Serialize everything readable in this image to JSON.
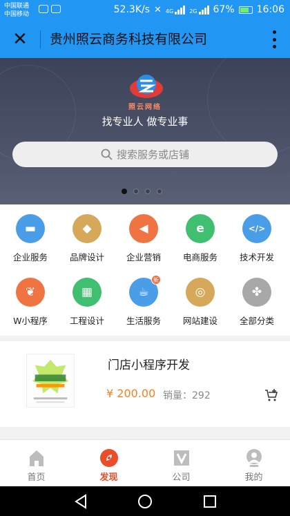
{
  "status_bar": {
    "carrier_1": "中国联通",
    "carrier_2": "中国移动",
    "net_speed": "52.3K/s",
    "sig1_tag": "4G",
    "sig2_tag": "2G",
    "battery": "67%",
    "time": "16:06"
  },
  "titlebar": {
    "title": "贵州照云商务科技有限公司"
  },
  "banner": {
    "logo_text": "照云网络",
    "slogan": "找专业人 做专业事",
    "search_placeholder": "搜索服务或店铺",
    "dots_total": 4,
    "dots_active": 1
  },
  "categories": [
    {
      "label": "企业服务",
      "icon": "briefcase-icon",
      "color": "#4a9ee8",
      "glyph": "▬"
    },
    {
      "label": "品牌设计",
      "icon": "tag-icon",
      "color": "#d6a85a",
      "glyph": "◆"
    },
    {
      "label": "企业营销",
      "icon": "megaphone-icon",
      "color": "#ef7441",
      "glyph": "◀"
    },
    {
      "label": "电商服务",
      "icon": "shopping-bag-icon",
      "color": "#3fbf6f",
      "glyph": "e"
    },
    {
      "label": "技术开发",
      "icon": "code-icon",
      "color": "#4a9ee8",
      "glyph": "</>"
    },
    {
      "label": "W小程序",
      "icon": "miniapp-icon",
      "color": "#ef7441",
      "glyph": "❦"
    },
    {
      "label": "工程设计",
      "icon": "building-icon",
      "color": "#3fbf6f",
      "glyph": "▦"
    },
    {
      "label": "生活服务",
      "icon": "coffee-icon",
      "color": "#4a9ee8",
      "glyph": "☕",
      "badge": "新"
    },
    {
      "label": "网站建设",
      "icon": "globe-icon",
      "color": "#d6a85a",
      "glyph": "◎"
    },
    {
      "label": "全部分类",
      "icon": "clover-icon",
      "color": "#a8a8a8",
      "glyph": "✤"
    }
  ],
  "product": {
    "name": "门店小程序开发",
    "price": "¥ 200.00",
    "sold": "销量：292"
  },
  "tabs": [
    {
      "label": "首页",
      "icon": "home-icon",
      "active": false
    },
    {
      "label": "发现",
      "icon": "discover-icon",
      "active": true
    },
    {
      "label": "公司",
      "icon": "company-icon",
      "active": false
    },
    {
      "label": "我的",
      "icon": "profile-icon",
      "active": false
    }
  ],
  "colors": {
    "primary": "#2196f3",
    "accent": "#e94d2a",
    "price": "#f5821f"
  }
}
